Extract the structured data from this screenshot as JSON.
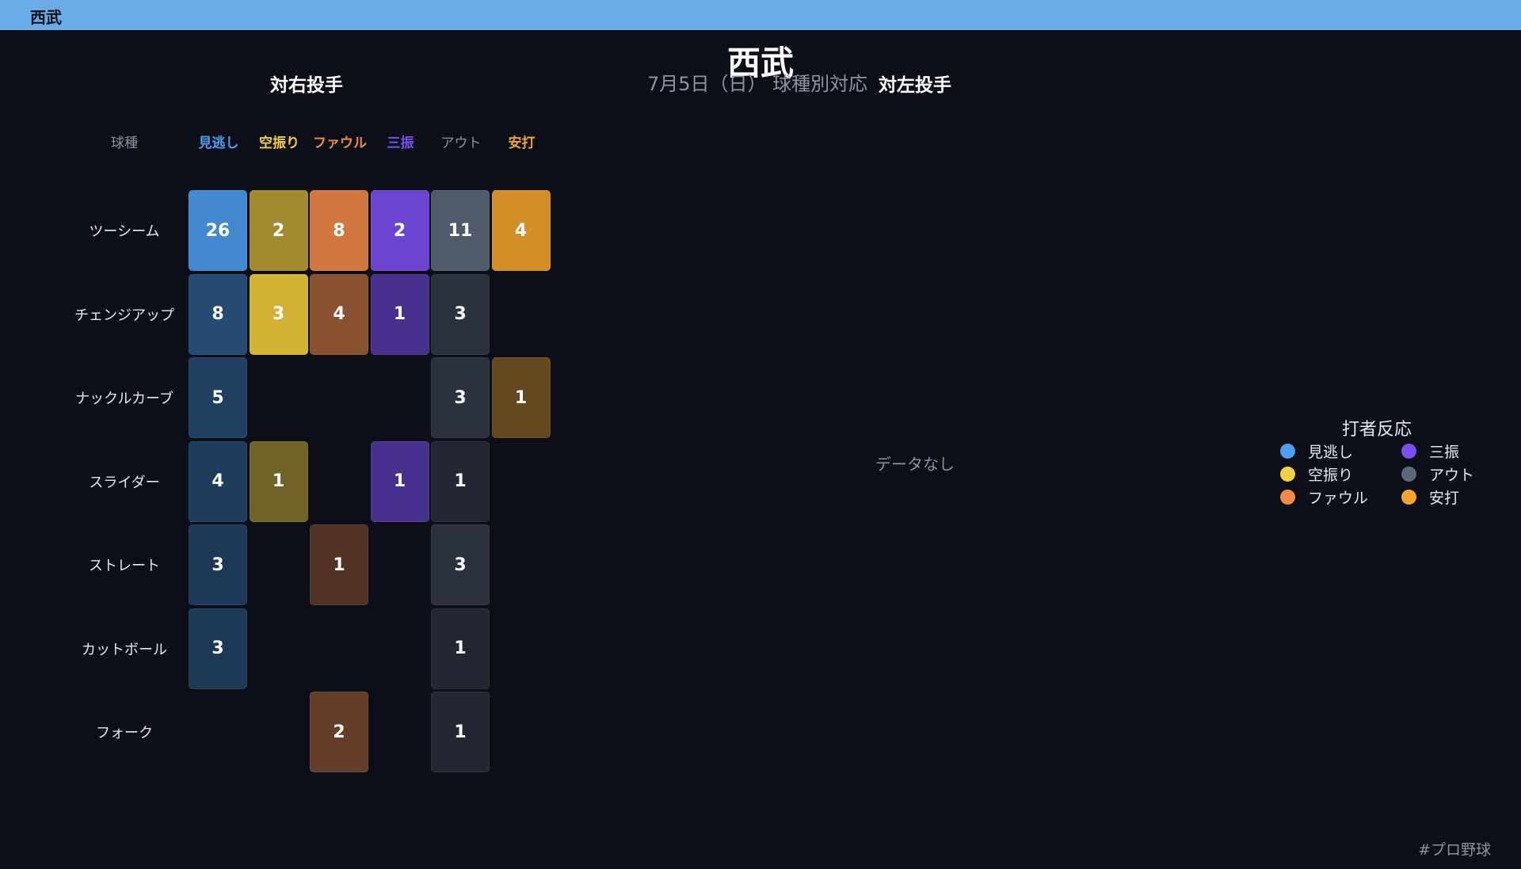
{
  "header": {
    "title": "西武"
  },
  "main_title": "西武",
  "subtitle": "7月5日（日） 球種別対応",
  "panels": {
    "right": {
      "title": "対右投手"
    },
    "left": {
      "title": "対左投手",
      "empty_text": "データなし"
    }
  },
  "colors": {
    "見逃し": "#4b9ef0",
    "空振り": "#f6cf3c",
    "ファウル": "#f38a46",
    "三振": "#7c4ef2",
    "アウト": "#5c6779",
    "安打": "#f5a52b"
  },
  "chart_data": {
    "type": "heatmap",
    "title": "対右投手",
    "row_header": "球種",
    "columns": [
      "見逃し",
      "空振り",
      "ファウル",
      "三振",
      "アウト",
      "安打"
    ],
    "rows": [
      "ツーシーム",
      "チェンジアップ",
      "ナックルカーブ",
      "スライダー",
      "ストレート",
      "カットボール",
      "フォーク"
    ],
    "values": [
      [
        26,
        2,
        8,
        2,
        11,
        4
      ],
      [
        8,
        3,
        4,
        1,
        3,
        null
      ],
      [
        5,
        null,
        null,
        null,
        3,
        1
      ],
      [
        4,
        1,
        null,
        1,
        1,
        null
      ],
      [
        3,
        null,
        1,
        null,
        3,
        null
      ],
      [
        3,
        null,
        null,
        null,
        1,
        null
      ],
      [
        null,
        null,
        2,
        null,
        1,
        null
      ]
    ]
  },
  "legend": {
    "title": "打者反応",
    "items": [
      "見逃し",
      "空振り",
      "ファウル",
      "三振",
      "アウト",
      "安打"
    ]
  },
  "footer": {
    "hashtag": "#プロ野球"
  }
}
